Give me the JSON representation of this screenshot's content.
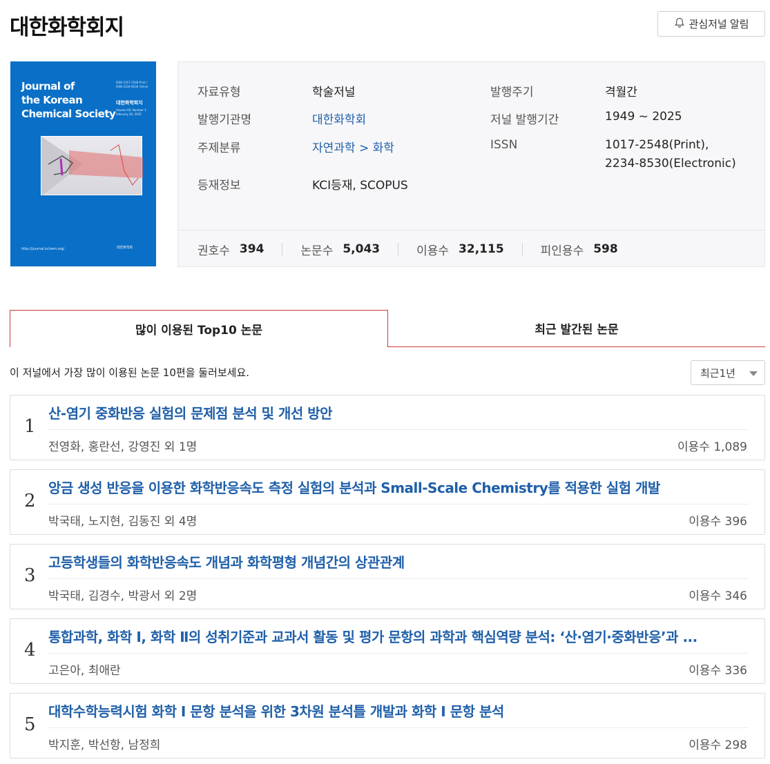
{
  "journal": {
    "title": "대한화학회지",
    "alert_label": "관심저널 알림"
  },
  "cover": {
    "title_lines": [
      "Journal of",
      "the Korean",
      "Chemical Society"
    ],
    "korean_title": "대한화학회지",
    "issn_small": "ISSN 1017-2548 Print / ISSN 2234-8530 Online",
    "volume": "Volume 69, Number 1 · February 20, 2025",
    "url": "http://journal.kchem.org/",
    "publisher_logo": "대한화학회"
  },
  "info": {
    "type_label": "자료유형",
    "type_value": "학술저널",
    "cycle_label": "발행주기",
    "cycle_value": "격월간",
    "publisher_label": "발행기관명",
    "publisher_value": "대한화학회",
    "period_label": "저널 발행기간",
    "period_value": "1949 ~ 2025",
    "subject_label": "주제분류",
    "subject_value": "자연과학 > 화학",
    "issn_label": "ISSN",
    "issn_print": "1017-2548(Print),",
    "issn_electronic": "2234-8530(Electronic)",
    "index_label": "등재정보",
    "index_value": "KCI등재, SCOPUS"
  },
  "stats": [
    {
      "label": "권호수",
      "value": "394"
    },
    {
      "label": "논문수",
      "value": "5,043"
    },
    {
      "label": "이용수",
      "value": "32,115"
    },
    {
      "label": "피인용수",
      "value": "598"
    }
  ],
  "tabs": {
    "top10": "많이 이용된 Top10 논문",
    "recent": "최근 발간된 논문"
  },
  "list": {
    "description": "이 저널에서 가장 많이 이용된 논문 10편을 둘러보세요.",
    "period_selected": "최근1년"
  },
  "papers": [
    {
      "rank": "1",
      "title": "산-염기 중화반응 실험의 문제점 분석 및 개선 방안",
      "authors": "전영화, 홍란선, 강영진 외 1명",
      "usage": "이용수 1,089"
    },
    {
      "rank": "2",
      "title": "앙금 생성 반응을 이용한 화학반응속도 측정 실험의 분석과 Small-Scale Chemistry를 적용한 실험 개발",
      "authors": "박국태, 노지현, 김동진 외 4명",
      "usage": "이용수 396"
    },
    {
      "rank": "3",
      "title": "고등학생들의 화학반응속도 개념과 화학평형 개념간의 상관관계",
      "authors": "박국태, 김경수, 박광서 외 2명",
      "usage": "이용수 346"
    },
    {
      "rank": "4",
      "title": "통합과학, 화학 Ⅰ, 화학 Ⅱ의 성취기준과 교과서 활동 및 평가 문항의 과학과 핵심역량 분석: ‘산·염기·중화반응’과 ...",
      "authors": "고은아, 최애란",
      "usage": "이용수 336"
    },
    {
      "rank": "5",
      "title": "대학수학능력시험 화학 I 문항 분석을 위한 3차원 분석틀 개발과 화학 I 문항 분석",
      "authors": "박지훈, 박선항, 남정희",
      "usage": "이용수 298"
    }
  ]
}
